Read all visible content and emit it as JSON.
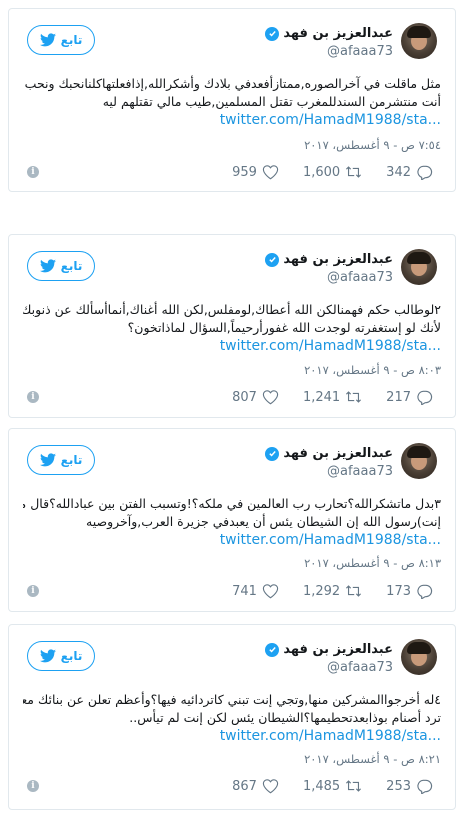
{
  "tweets": [
    {
      "follow_label": "تابع",
      "name": "عبدالعزيز بن فهد",
      "handle": "@afaaa73",
      "lines": [
        "مثل ماقلت في آخرالصوره,ممتازأفعدفي بلادك وأشكرالله,إذافعلتهاكلنانحبك ونحب ختسمك,لكن",
        "أنت منتشرمن السندللمغرب تقتل المسلمين,طيب مالي تقتلهم ليه"
      ],
      "link": "twitter.com/HamadM1988/sta...",
      "timestamp": "٧:٥٤ ص - ٩ أغسطس، ٢٠١٧",
      "replies": "342",
      "retweets": "1,600",
      "likes": "959"
    },
    {
      "follow_label": "تابع",
      "name": "عبدالعزيز بن فهد",
      "handle": "@afaaa73",
      "lines": [
        "٢لوطالب حكم فهمنالكن الله أعطاك,لومفلس,لكن الله أغناك,أنماأسألك عن ذنوبك على نفسك",
        "لأنك لو إستغفرته لوجدت الله غفورأرحيماً,السؤال لماذاتخون؟"
      ],
      "link": "twitter.com/HamadM1988/sta...",
      "timestamp": "٨:٠٣ ص - ٩ أغسطس، ٢٠١٧",
      "replies": "217",
      "retweets": "1,241",
      "likes": "807"
    },
    {
      "follow_label": "تابع",
      "name": "عبدالعزيز بن فهد",
      "handle": "@afaaa73",
      "lines": [
        "٣بدل ماتشكرالله؟تحارب رب العالمين في ملكه؟!وتسبب الفتن بين عبادالله؟قال محمد(موب",
        "إنت)رسول الله إن الشيطان يئس أن يعبدفي جزيرة العرب,وآخروصيه"
      ],
      "link": "twitter.com/HamadM1988/sta...",
      "timestamp": "٨:١٣ ص - ٩ أغسطس، ٢٠١٧",
      "replies": "173",
      "retweets": "1,292",
      "likes": "741"
    },
    {
      "follow_label": "تابع",
      "name": "عبدالعزيز بن فهد",
      "handle": "@afaaa73",
      "lines": [
        "٤له أخرجواالمشركين منها,وتجي إنت تبني كاتردائيه فيها؟وأعظم تعلن عن بنائك معبدلبوذا؟أي",
        "ترد أصنام بوذابعدتحطيمها؟الشيطان يئس لكن إنت لم تيأس.."
      ],
      "link": "twitter.com/HamadM1988/sta...",
      "timestamp": "٨:٢١ ص - ٩ أغسطس، ٢٠١٧",
      "replies": "253",
      "retweets": "1,485",
      "likes": "867"
    }
  ]
}
